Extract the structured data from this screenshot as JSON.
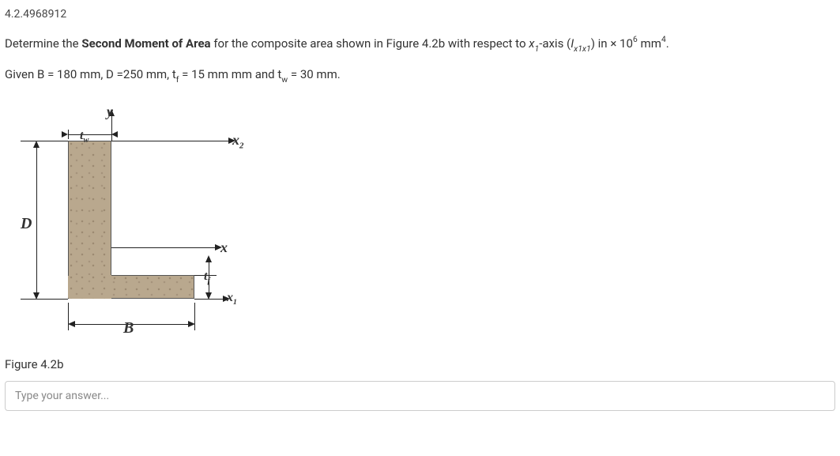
{
  "question_id": "4.2.4968912",
  "question": {
    "prefix": "Determine the ",
    "bold": "Second Moment of Area",
    "mid": " for the composite area shown in Figure 4.2b with respect to ",
    "axis_var": "x",
    "axis_sub": "1",
    "axis_suffix": "-axis (",
    "inertia_var": "I",
    "inertia_sub": "x1x1",
    "inertia_suffix": ") in × 10",
    "exp": "6",
    "unit": " mm",
    "unit_exp": "4",
    "end": "."
  },
  "given": {
    "prefix": "Given ",
    "B_sym": "B",
    "B": " = 180 mm, ",
    "D_sym": "D",
    "D": " =250 mm, ",
    "tf_sym": "t",
    "tf_sub": "f",
    "tf": " = 15 mm mm and ",
    "tw_sym": "t",
    "tw_sub": "w",
    "tw": " = 30 mm."
  },
  "figure": {
    "caption": "Figure 4.2b",
    "labels": {
      "y": "y",
      "tw": "t",
      "tw_sub": "w",
      "x2": "x",
      "x2_sub": "2",
      "D": "D",
      "x": "x",
      "tf": "t",
      "tf_sub": "f",
      "x1": "x",
      "x1_sub": "1",
      "B": "B"
    }
  },
  "answer": {
    "placeholder": "Type your answer..."
  }
}
